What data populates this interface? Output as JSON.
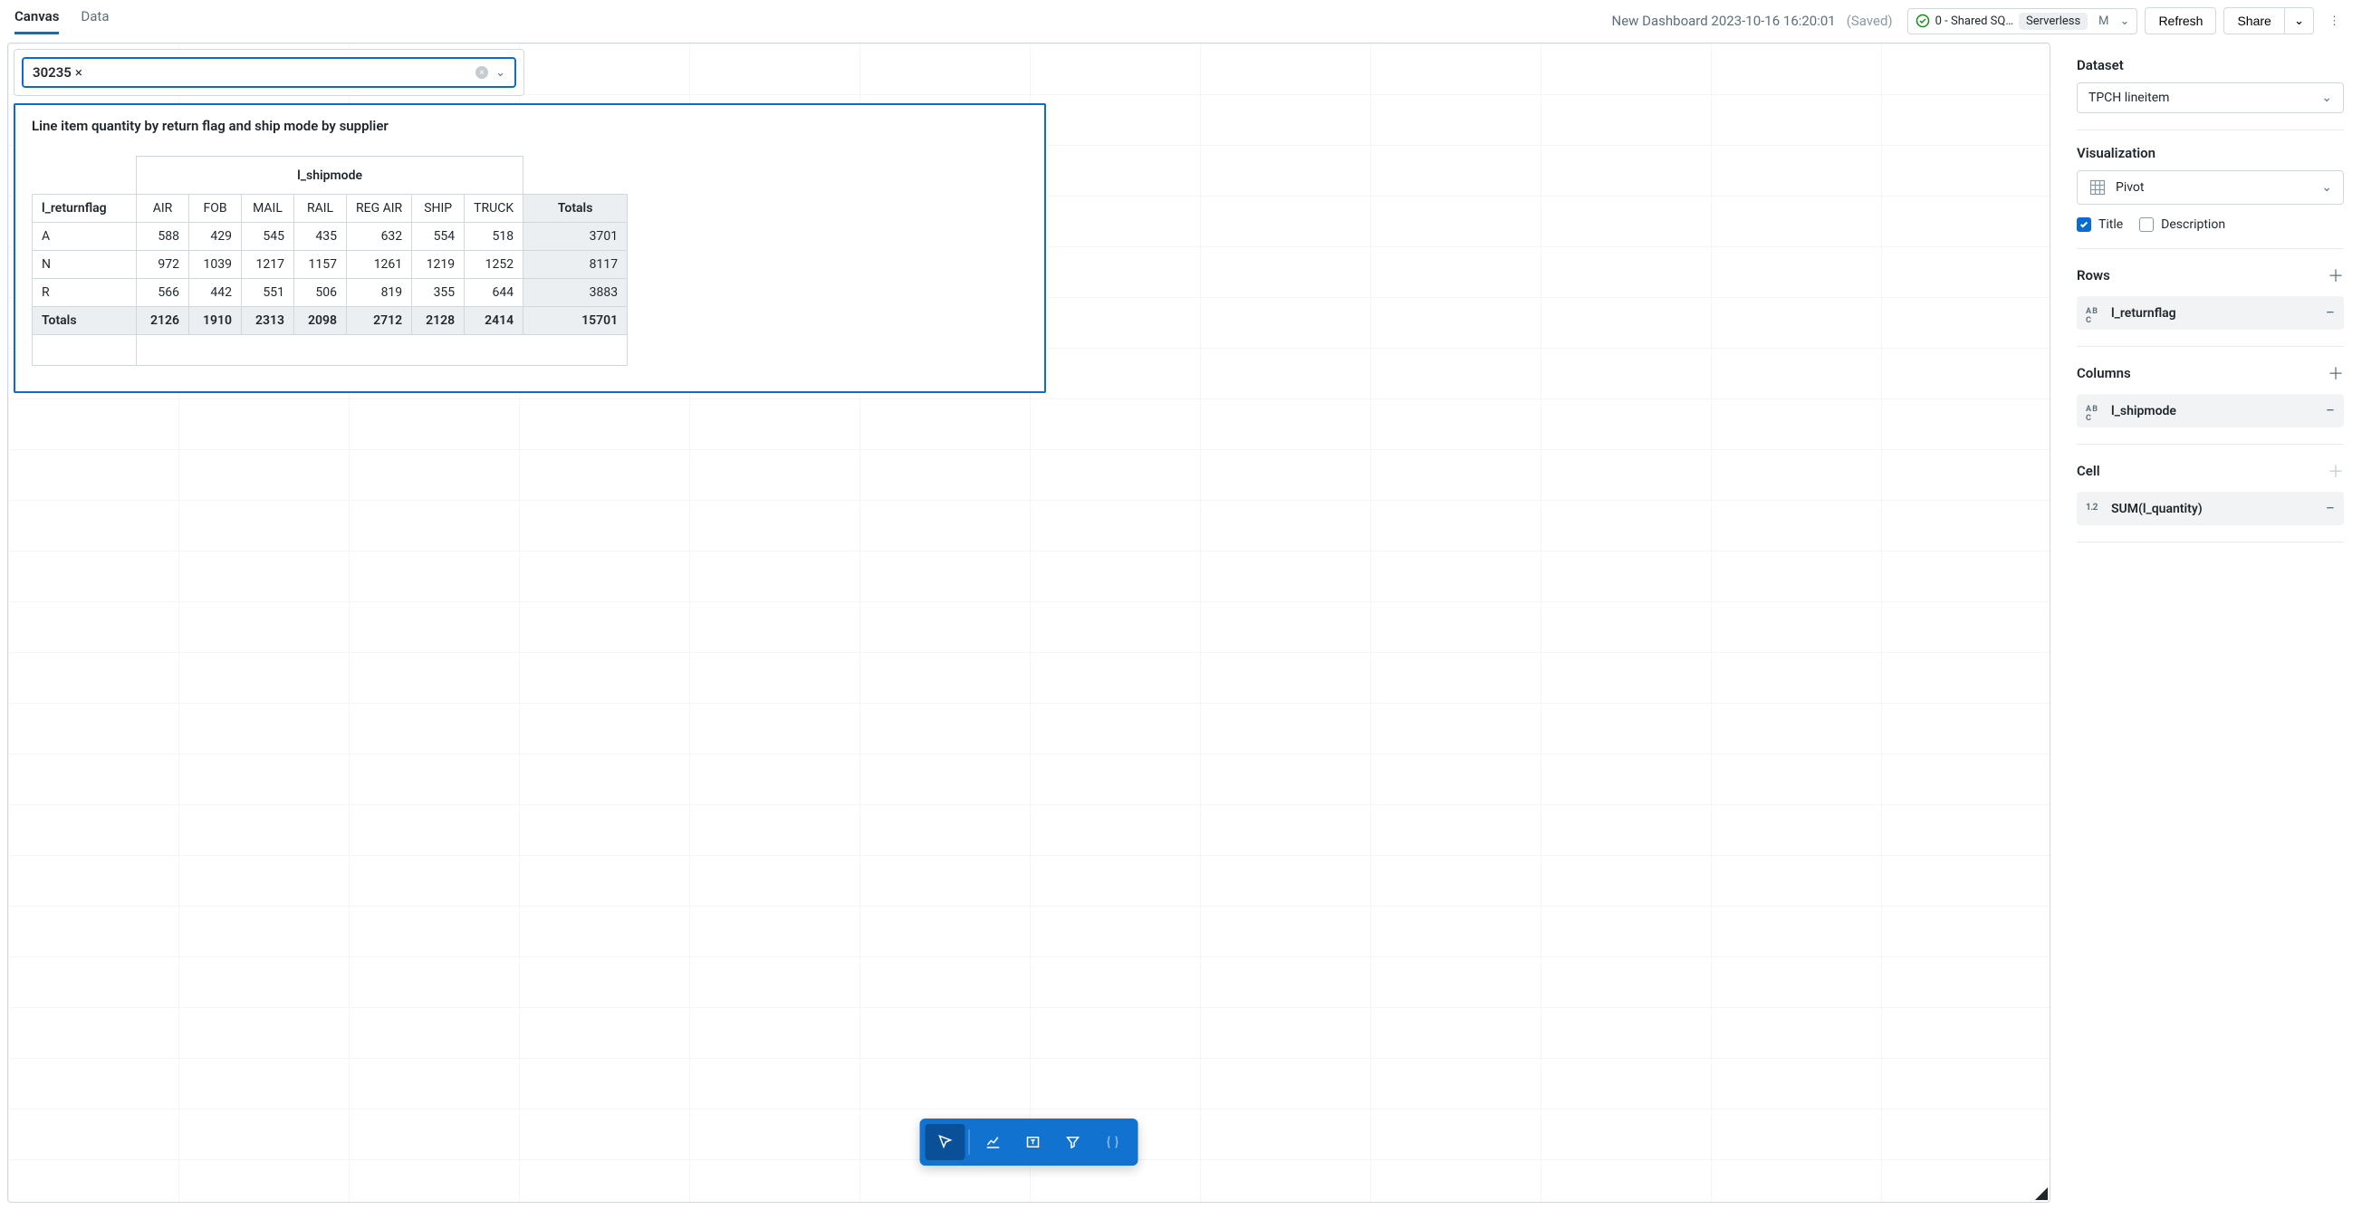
{
  "header": {
    "tabs": {
      "canvas": "Canvas",
      "data": "Data"
    },
    "title": "New Dashboard 2023-10-16 16:20:01",
    "saved": "(Saved)",
    "sql_label": "0 - Shared SQ…",
    "serverless": "Serverless",
    "size": "M",
    "refresh": "Refresh",
    "share": "Share"
  },
  "filter": {
    "tag_value": "30235",
    "tag_close": "×"
  },
  "pivot": {
    "title": "Line item quantity by return flag and ship mode by supplier",
    "super_col": "l_shipmode",
    "row_dim": "l_returnflag",
    "cols": [
      "AIR",
      "FOB",
      "MAIL",
      "RAIL",
      "REG AIR",
      "SHIP",
      "TRUCK"
    ],
    "totals_label": "Totals",
    "rows": [
      {
        "key": "A",
        "vals": [
          588,
          429,
          545,
          435,
          632,
          554,
          518
        ],
        "total": 3701
      },
      {
        "key": "N",
        "vals": [
          972,
          1039,
          1217,
          1157,
          1261,
          1219,
          1252
        ],
        "total": 8117
      },
      {
        "key": "R",
        "vals": [
          566,
          442,
          551,
          506,
          819,
          355,
          644
        ],
        "total": 3883
      }
    ],
    "col_totals": [
      2126,
      1910,
      2313,
      2098,
      2712,
      2128,
      2414
    ],
    "grand_total": 15701
  },
  "sidebar": {
    "dataset_heading": "Dataset",
    "dataset_value": "TPCH lineitem",
    "viz_heading": "Visualization",
    "viz_value": "Pivot",
    "title_check": "Title",
    "desc_check": "Description",
    "rows_heading": "Rows",
    "rows_field": "l_returnflag",
    "cols_heading": "Columns",
    "cols_field": "l_shipmode",
    "cell_heading": "Cell",
    "cell_field": "SUM(l_quantity)"
  },
  "chart_data": {
    "type": "table",
    "title": "Line item quantity by return flag and ship mode by supplier",
    "row_dimension": "l_returnflag",
    "col_dimension": "l_shipmode",
    "measure": "SUM(l_quantity)",
    "columns": [
      "AIR",
      "FOB",
      "MAIL",
      "RAIL",
      "REG AIR",
      "SHIP",
      "TRUCK",
      "Totals"
    ],
    "rows": {
      "A": [
        588,
        429,
        545,
        435,
        632,
        554,
        518,
        3701
      ],
      "N": [
        972,
        1039,
        1217,
        1157,
        1261,
        1219,
        1252,
        8117
      ],
      "R": [
        566,
        442,
        551,
        506,
        819,
        355,
        644,
        3883
      ],
      "Totals": [
        2126,
        1910,
        2313,
        2098,
        2712,
        2128,
        2414,
        15701
      ]
    }
  }
}
